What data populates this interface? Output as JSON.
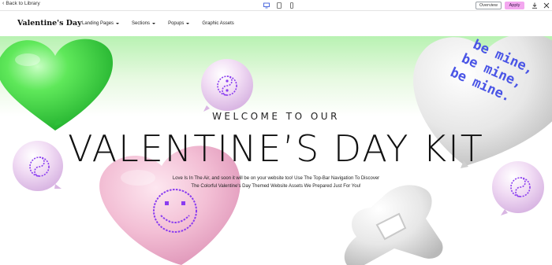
{
  "toolbar": {
    "back_label": "Back to Library",
    "overview_label": "Overview",
    "apply_label": "Apply",
    "device_icons": [
      "desktop-icon",
      "tablet-icon",
      "mobile-icon"
    ],
    "apply_color": "#f3a7ef"
  },
  "site": {
    "logo": "Valentine's Day",
    "nav": [
      {
        "label": "Landing Pages",
        "dropdown": true
      },
      {
        "label": "Sections",
        "dropdown": true
      },
      {
        "label": "Popups",
        "dropdown": true
      },
      {
        "label": "Graphic Assets",
        "dropdown": false
      }
    ]
  },
  "hero": {
    "eyebrow": "WELCOME TO OUR",
    "title": "VALENTINE’S DAY KIT",
    "intro": "Love Is In The Air, and soon it will be on your website too! Use The Top-Bar Navigation To Discover The Colorful Valentine's Day Themed Website Assets We Prepared Just For You!",
    "balloon_text": [
      "be mine,",
      "be mine,",
      "be mine."
    ],
    "colors": {
      "green": "#3fd94a",
      "pink": "#f2b6cf",
      "lilac": "#e9d3ee",
      "pixel": "#8a3cf0",
      "silver": "#e6e6e6",
      "text_blue": "#4a55e6"
    }
  }
}
